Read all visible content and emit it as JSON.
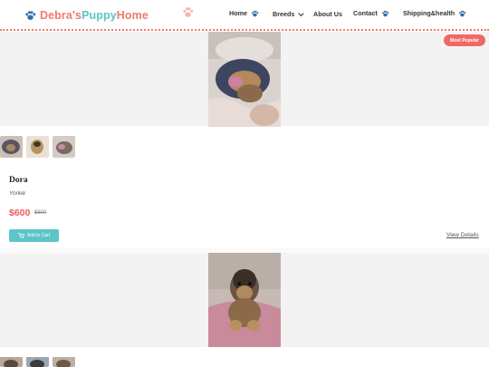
{
  "header": {
    "logo_part1": "Debra's",
    "logo_part2": "Puppy",
    "logo_part3": "Home",
    "nav": [
      {
        "label": "Home",
        "icon": "paw-icon"
      },
      {
        "label": "Breeds",
        "icon": "chevron-down-icon"
      },
      {
        "label": "About Us"
      },
      {
        "label": "Contact",
        "icon": "paw-icon"
      },
      {
        "label": "Shipping&health",
        "icon": "paw-icon"
      }
    ]
  },
  "products": [
    {
      "badge": "Most Popular",
      "name": "Dora",
      "breed": "Yorkie",
      "price": "$600",
      "old_price": "$800",
      "add_to_cart": "Add to Cart",
      "view_details": "View Details"
    }
  ],
  "colors": {
    "brand_coral": "#f07a6e",
    "brand_teal": "#5bc6c9",
    "price_red": "#ef5a5a",
    "badge_red": "#ef6a64"
  }
}
